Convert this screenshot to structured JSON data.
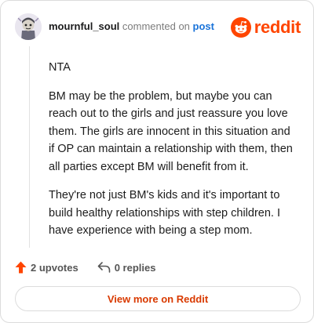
{
  "header": {
    "username": "mournful_soul",
    "action_text": "commented on",
    "post_link": "post",
    "brand": "reddit"
  },
  "comment": {
    "paragraphs": [
      "NTA",
      "BM may be the problem, but maybe you can reach out to the girls and just reassure you love them. The girls are innocent in this situation and if OP can maintain a relationship with them, then all parties except BM will benefit from it.",
      "They're not just BM's kids and it's important to build healthy relationships with step children. I have experience with being a step mom."
    ]
  },
  "actions": {
    "upvotes": "2 upvotes",
    "replies": "0 replies"
  },
  "footer": {
    "view_more": "View more on Reddit"
  },
  "colors": {
    "brand": "#ff4500",
    "link": "#1a73d9",
    "view_more": "#d93a00"
  },
  "icons": [
    "avatar",
    "reddit-logo-icon",
    "upvote-arrow-icon",
    "reply-icon"
  ]
}
